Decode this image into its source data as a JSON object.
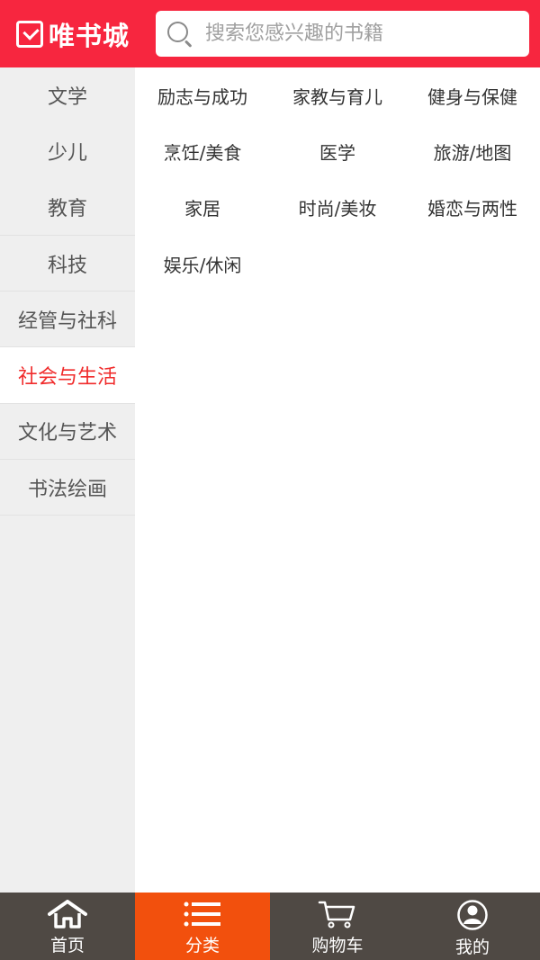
{
  "header": {
    "logo_text": "唯书城",
    "search_placeholder": "搜索您感兴趣的书籍"
  },
  "sidebar": {
    "items": [
      {
        "label": "文学"
      },
      {
        "label": "少儿"
      },
      {
        "label": "教育"
      },
      {
        "label": "科技"
      },
      {
        "label": "经管与社科"
      },
      {
        "label": "社会与生活"
      },
      {
        "label": "文化与艺术"
      },
      {
        "label": "书法绘画"
      }
    ],
    "active_index": 5
  },
  "categories": [
    {
      "label": "励志与成功"
    },
    {
      "label": "家教与育儿"
    },
    {
      "label": "健身与保健"
    },
    {
      "label": "烹饪/美食"
    },
    {
      "label": "医学"
    },
    {
      "label": "旅游/地图"
    },
    {
      "label": "家居"
    },
    {
      "label": "时尚/美妆"
    },
    {
      "label": "婚恋与两性"
    },
    {
      "label": "娱乐/休闲"
    }
  ],
  "tabbar": {
    "tabs": [
      {
        "label": "首页",
        "icon": "home-icon"
      },
      {
        "label": "分类",
        "icon": "list-icon"
      },
      {
        "label": "购物车",
        "icon": "cart-icon"
      },
      {
        "label": "我的",
        "icon": "user-icon"
      }
    ],
    "active_index": 1
  },
  "colors": {
    "brand_red": "#f7263f",
    "active_text": "#f02b2b",
    "active_tab": "#f2500d",
    "tabbar_bg": "#4f4944"
  }
}
